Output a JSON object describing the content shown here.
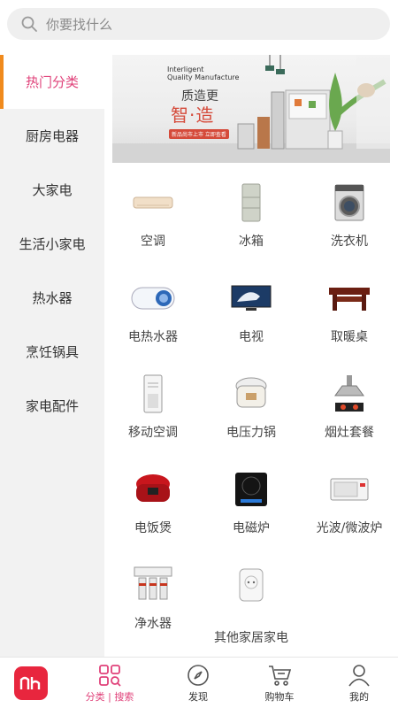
{
  "search": {
    "placeholder": "你要找什么"
  },
  "sidebar": {
    "items": [
      {
        "label": "热门分类",
        "active": true
      },
      {
        "label": "厨房电器"
      },
      {
        "label": "大家电"
      },
      {
        "label": "生活小家电"
      },
      {
        "label": "热水器"
      },
      {
        "label": "烹饪锅具"
      },
      {
        "label": "家电配件"
      }
    ]
  },
  "banner": {
    "en_line1": "Interligent",
    "en_line2": "Quality Manufacture",
    "zh_line1": "质造更",
    "zh_line2": "智·造",
    "tag": "新品尚市上市 立即查看"
  },
  "products": [
    {
      "label": "空调",
      "icon": "air-conditioner-icon"
    },
    {
      "label": "冰箱",
      "icon": "fridge-icon"
    },
    {
      "label": "洗衣机",
      "icon": "washing-machine-icon"
    },
    {
      "label": "电热水器",
      "icon": "electric-water-heater-icon"
    },
    {
      "label": "电视",
      "icon": "tv-icon"
    },
    {
      "label": "取暖桌",
      "icon": "heating-table-icon"
    },
    {
      "label": "移动空调",
      "icon": "portable-ac-icon"
    },
    {
      "label": "电压力锅",
      "icon": "pressure-cooker-icon"
    },
    {
      "label": "烟灶套餐",
      "icon": "hood-stove-icon"
    },
    {
      "label": "电饭煲",
      "icon": "rice-cooker-icon"
    },
    {
      "label": "电磁炉",
      "icon": "induction-cooker-icon"
    },
    {
      "label": "光波/微波炉",
      "icon": "microwave-icon"
    },
    {
      "label": "净水器",
      "icon": "water-purifier-icon"
    },
    {
      "label": "其他家居家电",
      "icon": "smart-plug-icon"
    }
  ],
  "tabbar": {
    "items": [
      {
        "label": "分类 | 搜索",
        "icon": "category-icon",
        "active": true
      },
      {
        "label": "发现",
        "icon": "compass-icon"
      },
      {
        "label": "购物车",
        "icon": "cart-icon"
      },
      {
        "label": "我的",
        "icon": "user-icon"
      }
    ]
  },
  "colors": {
    "accent": "#e0427a",
    "indicator": "#f08a1d",
    "logo": "#e8263e"
  }
}
